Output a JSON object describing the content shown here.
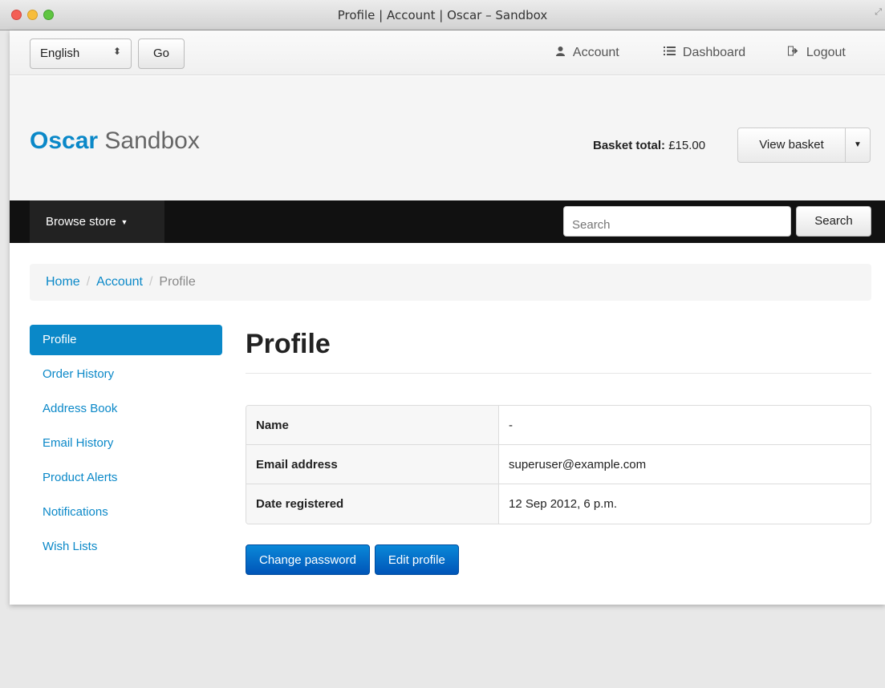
{
  "window": {
    "title": "Profile | Account | Oscar – Sandbox"
  },
  "topbar": {
    "language": "English",
    "go_label": "Go",
    "links": [
      {
        "icon": "user-icon",
        "label": "Account"
      },
      {
        "icon": "list-icon",
        "label": "Dashboard"
      },
      {
        "icon": "logout-icon",
        "label": "Logout"
      }
    ]
  },
  "header": {
    "brand_strong": "Oscar",
    "brand_light": "Sandbox",
    "basket_label": "Basket total:",
    "basket_total": "£15.00",
    "view_basket": "View basket"
  },
  "nav": {
    "browse": "Browse store",
    "search_placeholder": "Search",
    "search_button": "Search"
  },
  "breadcrumb": {
    "items": [
      "Home",
      "Account"
    ],
    "active": "Profile"
  },
  "sidebar": {
    "items": [
      {
        "label": "Profile",
        "active": true
      },
      {
        "label": "Order History"
      },
      {
        "label": "Address Book"
      },
      {
        "label": "Email History"
      },
      {
        "label": "Product Alerts"
      },
      {
        "label": "Notifications"
      },
      {
        "label": "Wish Lists"
      }
    ]
  },
  "main": {
    "title": "Profile",
    "rows": [
      {
        "key": "Name",
        "value": "-"
      },
      {
        "key": "Email address",
        "value": "superuser@example.com"
      },
      {
        "key": "Date registered",
        "value": "12 Sep 2012, 6 p.m."
      }
    ],
    "change_password": "Change password",
    "edit_profile": "Edit profile"
  },
  "colors": {
    "accent": "#0a88c8",
    "navbar": "#111111",
    "primary_button": "#0055b8"
  }
}
